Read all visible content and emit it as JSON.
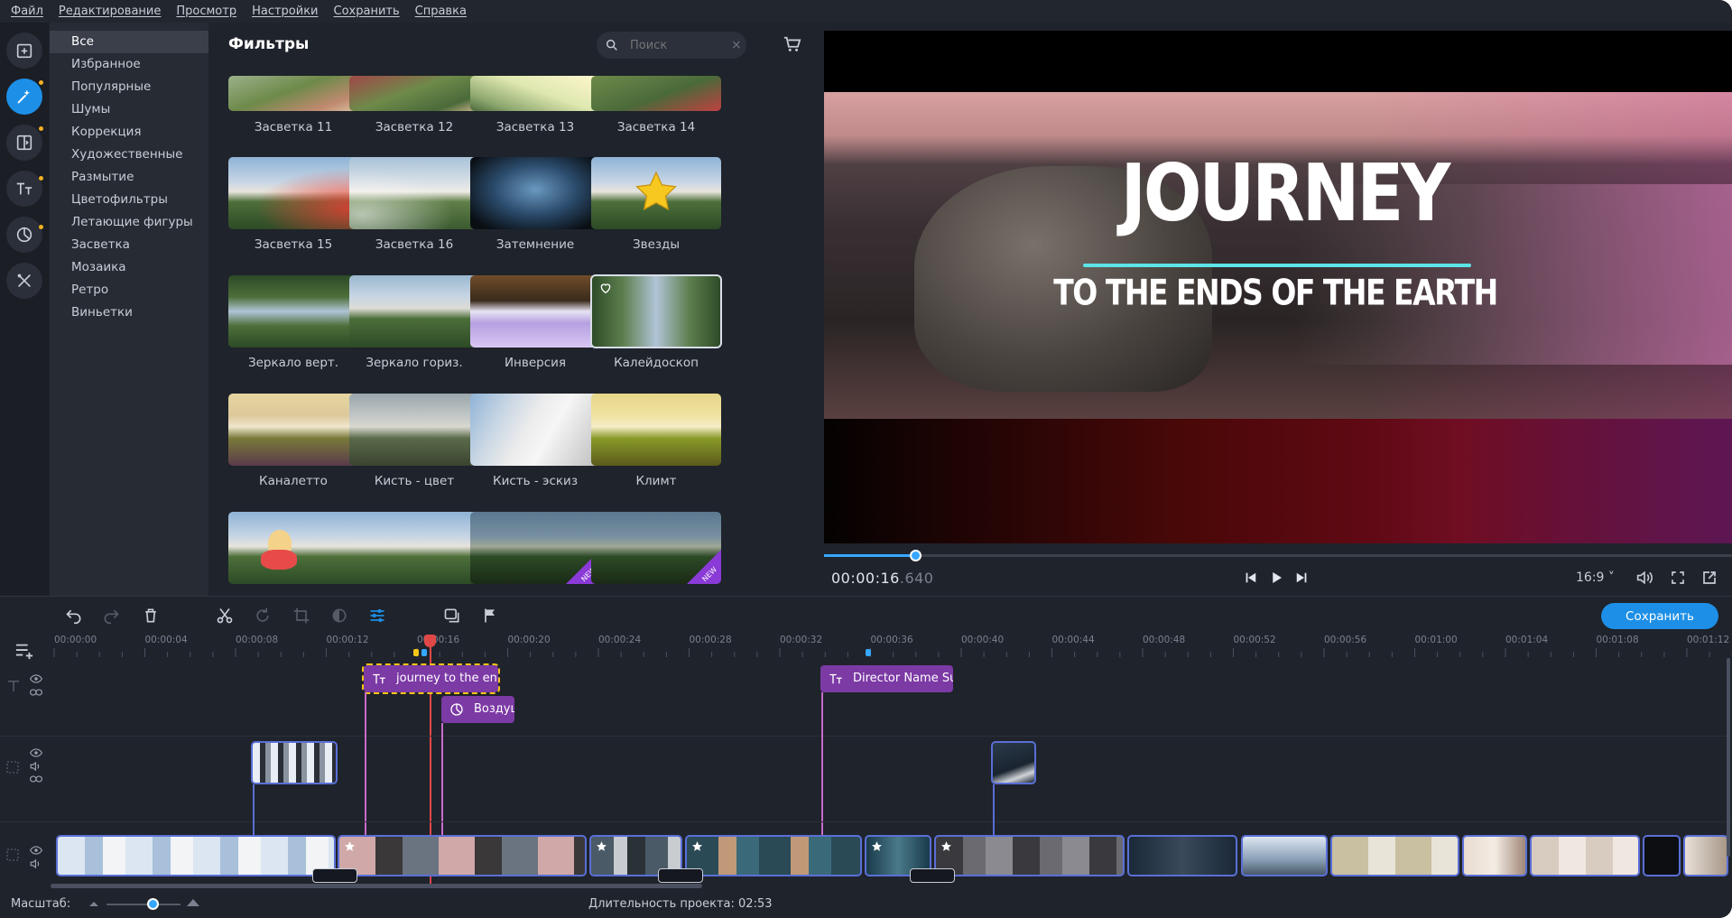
{
  "menu": [
    "Файл",
    "Редактирование",
    "Просмотр",
    "Настройки",
    "Сохранить",
    "Справка"
  ],
  "rail_icons": [
    "import-icon",
    "filters-icon",
    "transitions-icon",
    "titles-icon",
    "stickers-icon",
    "tools-icon"
  ],
  "categories": [
    "Все",
    "Избранное",
    "Популярные",
    "Шумы",
    "Коррекция",
    "Художественные",
    "Размытие",
    "Цветофильтры",
    "Летающие фигуры",
    "Засветка",
    "Мозаика",
    "Ретро",
    "Виньетки"
  ],
  "panel": {
    "title": "Фильтры",
    "search_placeholder": "Поиск",
    "clear": "×"
  },
  "filters": [
    {
      "label": "Засветка 11"
    },
    {
      "label": "Засветка 12"
    },
    {
      "label": "Засветка 13"
    },
    {
      "label": "Засветка 14"
    },
    {
      "label": "Засветка 15"
    },
    {
      "label": "Засветка 16"
    },
    {
      "label": "Затемнение"
    },
    {
      "label": "Звезды"
    },
    {
      "label": "Зеркало верт."
    },
    {
      "label": "Зеркало гориз."
    },
    {
      "label": "Инверсия"
    },
    {
      "label": "Калейдоскоп"
    },
    {
      "label": "Каналетто"
    },
    {
      "label": "Кисть - цвет"
    },
    {
      "label": "Кисть - эскиз"
    },
    {
      "label": "Климт"
    },
    {
      "label": ""
    },
    {
      "label": ""
    },
    {
      "label": ""
    },
    {
      "label": ""
    }
  ],
  "badges": {
    "new": "NEW"
  },
  "preview": {
    "title_main": "JOURNEY",
    "title_sub": "TO THE ENDS OF THE EARTH",
    "progress": 0.1,
    "timecode_main": "00:00:16",
    "timecode_ms": ".640",
    "aspect": "16:9 ˅"
  },
  "timeline": {
    "save_label": "Сохранить",
    "ruler": [
      "00:00:00",
      "00:00:04",
      "00:00:08",
      "00:00:12",
      "00:00:16",
      "00:00:20",
      "00:00:24",
      "00:00:28",
      "00:00:32",
      "00:00:36",
      "00:00:40",
      "00:00:44",
      "00:00:48",
      "00:00:52",
      "00:00:56",
      "00:01:00",
      "00:01:04",
      "00:01:08",
      "00:01:12"
    ],
    "text_clips": [
      "journey to the en",
      "Воздуш",
      "Director Name Sur"
    ],
    "zoom_label": "Масштаб:",
    "duration": "Длительность проекта: 02:53"
  },
  "colors": {
    "accent": "#1d8fe6",
    "title_clip": "#7c3aa5",
    "playhead": "#e04848",
    "selection": "#f5c518"
  }
}
